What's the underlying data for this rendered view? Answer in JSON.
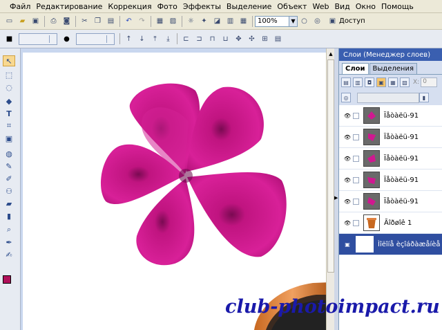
{
  "menu": [
    "Файл",
    "Редактирование",
    "Коррекция",
    "Фото",
    "Эффекты",
    "Выделение",
    "Объект",
    "Web",
    "Вид",
    "Окно",
    "Помощь"
  ],
  "toolbar": {
    "zoom_value": "100%",
    "access_label": "Доступ"
  },
  "panel": {
    "title": "Слои (Менеджер слоев)",
    "tabs": [
      {
        "label": "Слои",
        "active": true
      },
      {
        "label": "Выделения",
        "active": false
      }
    ],
    "x_label": "X:",
    "x_value": "0",
    "layers": [
      {
        "name": "Ïåòàëü-91",
        "thumb": "petal"
      },
      {
        "name": "Ïåòàëü-91",
        "thumb": "petal"
      },
      {
        "name": "Ïåòàëü-91",
        "thumb": "petal"
      },
      {
        "name": "Ïåòàëü-91",
        "thumb": "petal"
      },
      {
        "name": "Ïåòàëü-91",
        "thumb": "petal"
      },
      {
        "name": "Ãîðøîê 1",
        "thumb": "pot"
      },
      {
        "name": "Ìîëîíå èçîáðàæåíèå",
        "thumb": "white",
        "selected": true
      }
    ]
  },
  "colors": {
    "flower": "#cc1a8c",
    "flower_dark": "#9a0a66",
    "foreground": "#b0105a",
    "background": "#ffffff"
  },
  "watermark": "club-photoimpact.ru"
}
